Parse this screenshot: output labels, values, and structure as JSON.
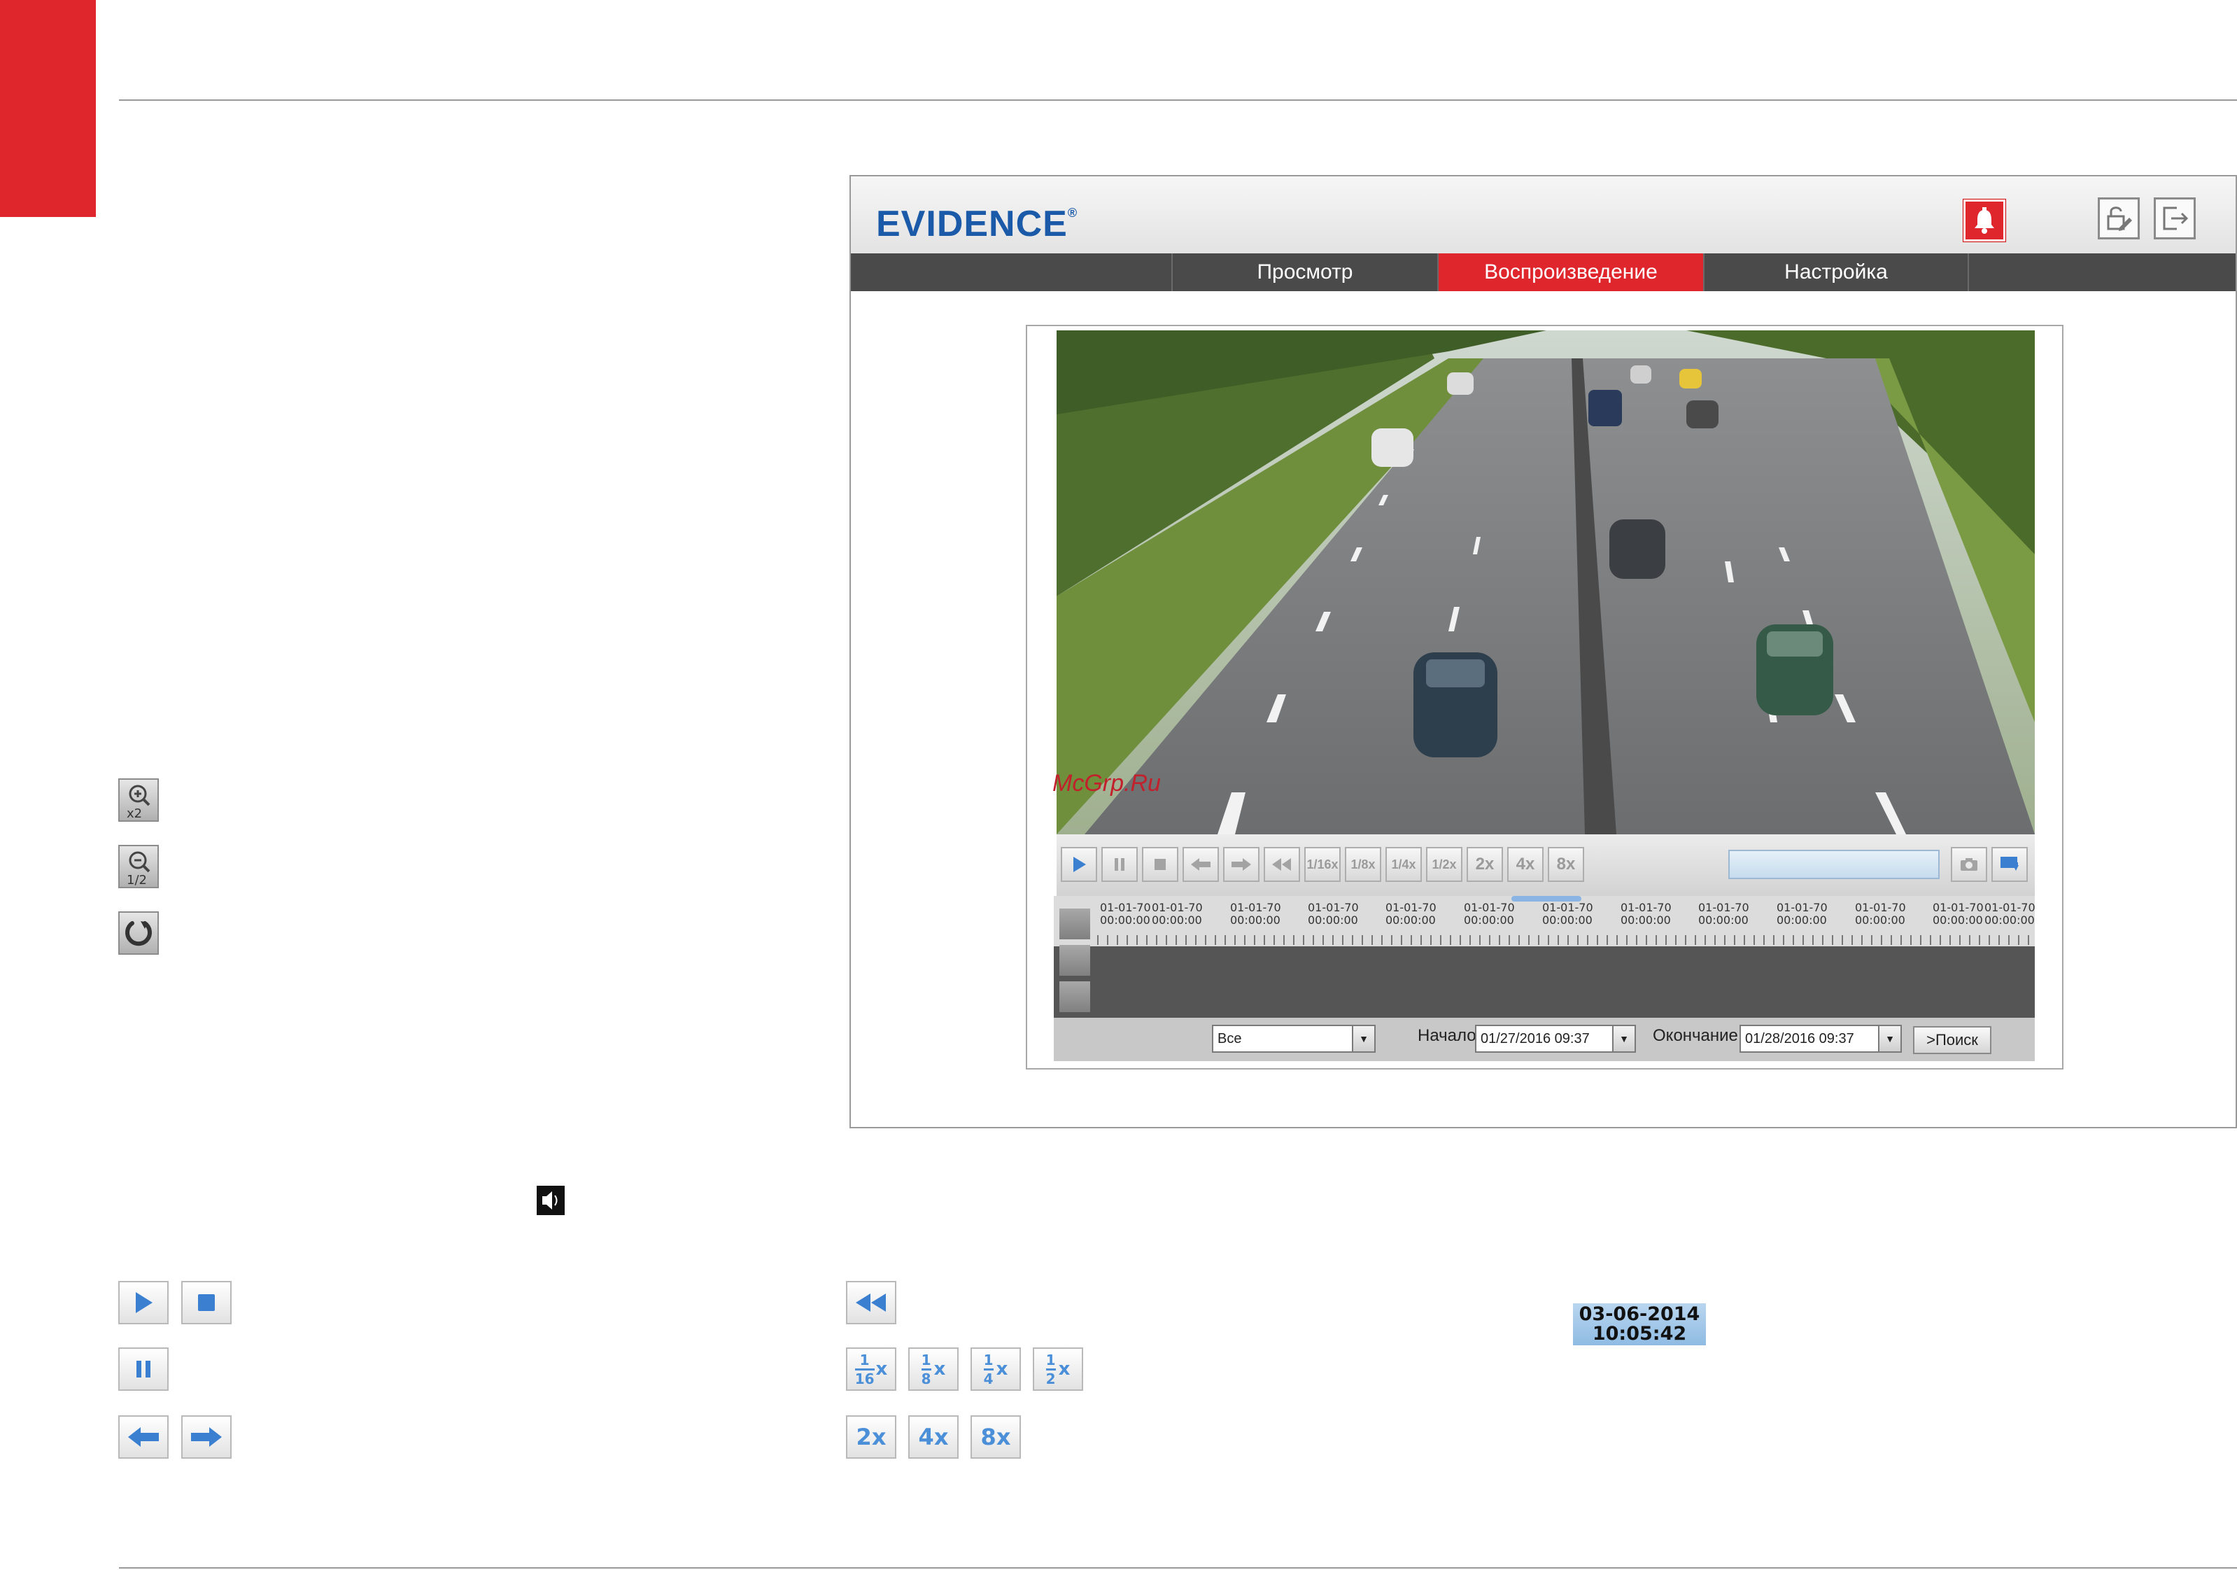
{
  "page": {
    "accent_color": "#e0262d"
  },
  "app": {
    "logo_text": "EVIDENCE",
    "logo_mark": "®",
    "nav_tabs": [
      {
        "label": "Просмотр",
        "active": false
      },
      {
        "label": "Воспроизведение",
        "active": true
      },
      {
        "label": "Настройка",
        "active": false
      }
    ],
    "header_icons": [
      "alarm-bell-icon",
      "lock-edit-icon",
      "logout-icon"
    ]
  },
  "player": {
    "speed_buttons": [
      "1/16x",
      "1/8x",
      "1/4x",
      "1/2x",
      "2x",
      "4x",
      "8x"
    ],
    "timeline_labels": [
      "01-01-70\n00:00:00",
      "01-01-70\n00:00:00",
      "01-01-70\n00:00:00",
      "01-01-70\n00:00:00",
      "01-01-70\n00:00:00",
      "01-01-70\n00:00:00",
      "01-01-70\n00:00:00",
      "01-01-70\n00:00:00",
      "01-01-70\n00:00:00",
      "01-01-70\n00:00:00",
      "01-01-70\n00:00:00",
      "01-01-70\n00:00:00",
      "01-01-70\n00:00:00"
    ],
    "filter_value": "Все",
    "start_label": "Начало",
    "start_value": "01/27/2016  09:37",
    "end_label": "Окончание",
    "end_value": "01/28/2016  09:37",
    "search_button": ">Поиск"
  },
  "legend": {
    "zoom_in_icon": "zoom-in-x2-icon",
    "zoom_in_text": "x2",
    "zoom_out_icon": "zoom-out-half-icon",
    "zoom_out_text": "1/2",
    "refresh_icon": "refresh-icon",
    "speaker_icon": "speaker-icon",
    "speeds_slow": [
      {
        "num": "1",
        "den": "16"
      },
      {
        "num": "1",
        "den": "8"
      },
      {
        "num": "1",
        "den": "4"
      },
      {
        "num": "1",
        "den": "2"
      }
    ],
    "speeds_fast": [
      "2x",
      "4x",
      "8x"
    ],
    "speed_suffix": "x",
    "datetime_date": "03-06-2014",
    "datetime_time": "10:05:42"
  },
  "watermark": "McGrp.Ru"
}
